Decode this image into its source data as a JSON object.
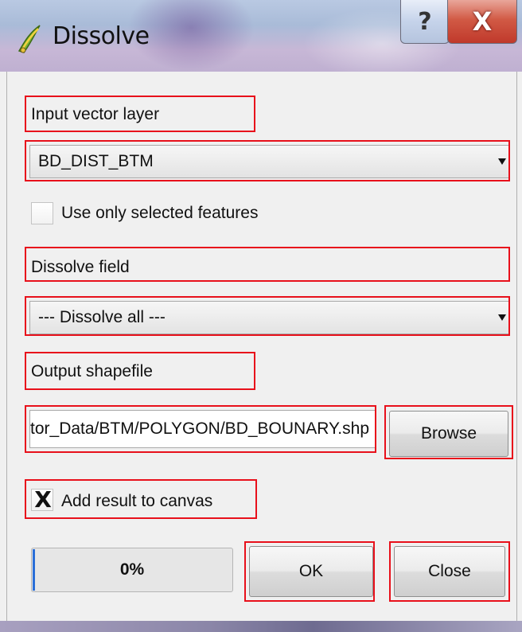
{
  "window": {
    "title": "Dissolve",
    "help_glyph": "?",
    "close_glyph": "X"
  },
  "input_layer": {
    "label": "Input vector layer",
    "value": "BD_DIST_BTM"
  },
  "selected_only": {
    "label": "Use only selected features",
    "checked": false
  },
  "dissolve_field": {
    "label": "Dissolve field",
    "value": "--- Dissolve all ---"
  },
  "output": {
    "label": "Output shapefile",
    "value": "ector_Data/BTM/POLYGON/BD_BOUNARY.shp",
    "browse_label": "Browse"
  },
  "add_to_canvas": {
    "label": "Add result to canvas",
    "checked": true,
    "mark": "X"
  },
  "progress": {
    "text": "0%",
    "value": 0
  },
  "buttons": {
    "ok_label": "OK",
    "close_label": "Close"
  },
  "colors": {
    "highlight": "#e8101b",
    "progress_fill": "#2a6ed8",
    "close_button": "#c0392b"
  },
  "icons": {
    "app": "qgis-dissolve-icon",
    "help": "help-icon",
    "close": "close-icon",
    "dropdown": "chevron-down-icon"
  }
}
